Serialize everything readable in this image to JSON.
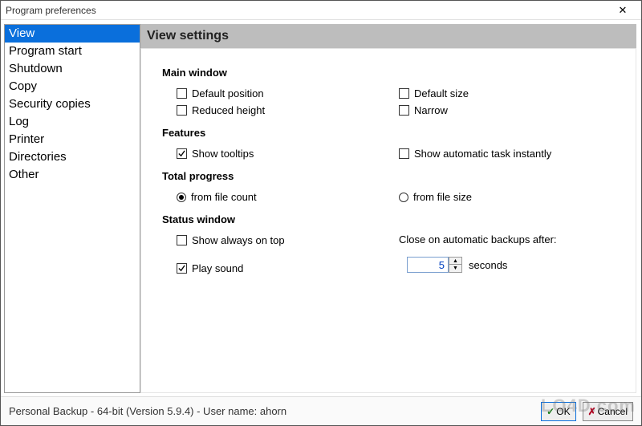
{
  "window": {
    "title": "Program preferences",
    "close_label": "Close"
  },
  "sidebar": {
    "items": [
      "View",
      "Program start",
      "Shutdown",
      "Copy",
      "Security copies",
      "Log",
      "Printer",
      "Directories",
      "Other"
    ],
    "selected_index": 0
  },
  "main": {
    "header": "View settings",
    "groups": {
      "main_window": {
        "title": "Main window",
        "default_position": {
          "label": "Default position",
          "checked": false
        },
        "default_size": {
          "label": "Default size",
          "checked": false
        },
        "reduced_height": {
          "label": "Reduced height",
          "checked": false
        },
        "narrow": {
          "label": "Narrow",
          "checked": false
        }
      },
      "features": {
        "title": "Features",
        "show_tooltips": {
          "label": "Show tooltips",
          "checked": true
        },
        "show_auto_task": {
          "label": "Show automatic task instantly",
          "checked": false
        }
      },
      "total_progress": {
        "title": "Total progress",
        "from_file_count": {
          "label": "from file count",
          "selected": true
        },
        "from_file_size": {
          "label": "from file size",
          "selected": false
        }
      },
      "status_window": {
        "title": "Status window",
        "show_on_top": {
          "label": "Show always on top",
          "checked": false
        },
        "play_sound": {
          "label": "Play sound",
          "checked": true
        },
        "close_after_label": "Close on automatic backups after:",
        "close_after_value": "5",
        "close_after_unit": "seconds"
      }
    }
  },
  "footer": {
    "status": "Personal Backup - 64-bit (Version 5.9.4) - User name: ahorn",
    "ok": "OK",
    "cancel": "Cancel"
  },
  "watermark": "LO4D.com"
}
